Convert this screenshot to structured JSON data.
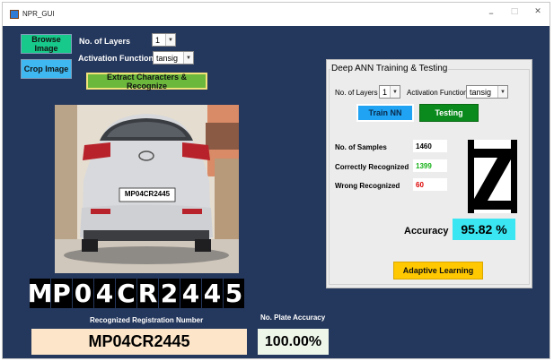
{
  "window": {
    "title": "NPR_GUI",
    "controls": [
      "–",
      "□",
      "✕"
    ]
  },
  "left": {
    "browse_button": "Browse Image",
    "crop_button": "Crop Image",
    "layers_label": "No. of Layers",
    "layers_value": "1",
    "activation_label": "Activation Function",
    "activation_value": "tansig",
    "extract_button": "Extract Characters & Recognize",
    "photo_plate_text": "MP04CR2445",
    "segmented_chars": [
      "M",
      "P",
      "0",
      "4",
      "C",
      "R",
      "2",
      "4",
      "4",
      "5"
    ],
    "recognized_label": "Recognized Registration Number",
    "recognized_value": "MP04CR2445",
    "accuracy_label": "No. Plate Accuracy",
    "accuracy_value": "100.00%"
  },
  "panel": {
    "title": "Deep ANN Training & Testing",
    "layers_label": "No. of Layers",
    "layers_value": "1",
    "activation_label": "Activation Function",
    "activation_value": "tansig",
    "train_button": "Train NN",
    "test_button": "Testing",
    "samples_label": "No. of Samples",
    "samples_value": "1460",
    "correct_label": "Correctly Recognized",
    "correct_value": "1399",
    "wrong_label": "Wrong Recognized",
    "wrong_value": "60",
    "preview_char": "Z",
    "accuracy_label": "Accuracy",
    "accuracy_value": "95.82 %",
    "adaptive_button": "Adaptive Learning"
  },
  "colors": {
    "background": "#24375c",
    "browse": "#17c98a",
    "crop": "#3fb7f0",
    "extract": "#6bb83c",
    "train": "#1fa3f2",
    "test": "#0a8a1c",
    "adaptive": "#ffc800",
    "accuracy_box": "#39e6f2",
    "result_box": "#fce5c8",
    "correct_green": "#18b21a",
    "wrong_red": "#dd0000"
  }
}
